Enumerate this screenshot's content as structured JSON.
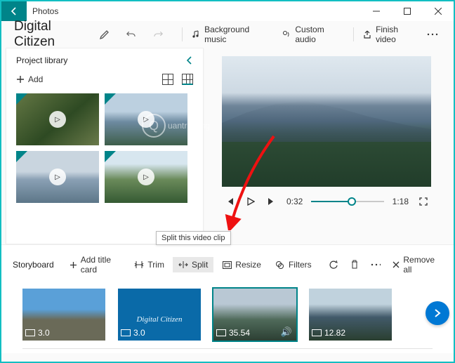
{
  "window": {
    "title": "Photos"
  },
  "project": {
    "name": "Digital Citizen"
  },
  "toolbar": {
    "background_music": "Background music",
    "custom_audio": "Custom audio",
    "finish_video": "Finish video"
  },
  "library": {
    "title": "Project library",
    "add_label": "Add"
  },
  "playback": {
    "current": "0:32",
    "duration": "1:18"
  },
  "storyboard": {
    "title": "Storyboard",
    "add_title_card": "Add title card",
    "trim": "Trim",
    "split": "Split",
    "resize": "Resize",
    "filters": "Filters",
    "remove_all": "Remove all",
    "tooltip_split": "Split this video clip"
  },
  "clips": [
    {
      "duration": "3.0"
    },
    {
      "duration": "3.0",
      "caption": "Digital Citizen"
    },
    {
      "duration": "35.54"
    },
    {
      "duration": "12.82"
    }
  ],
  "watermark": "uantrimang"
}
